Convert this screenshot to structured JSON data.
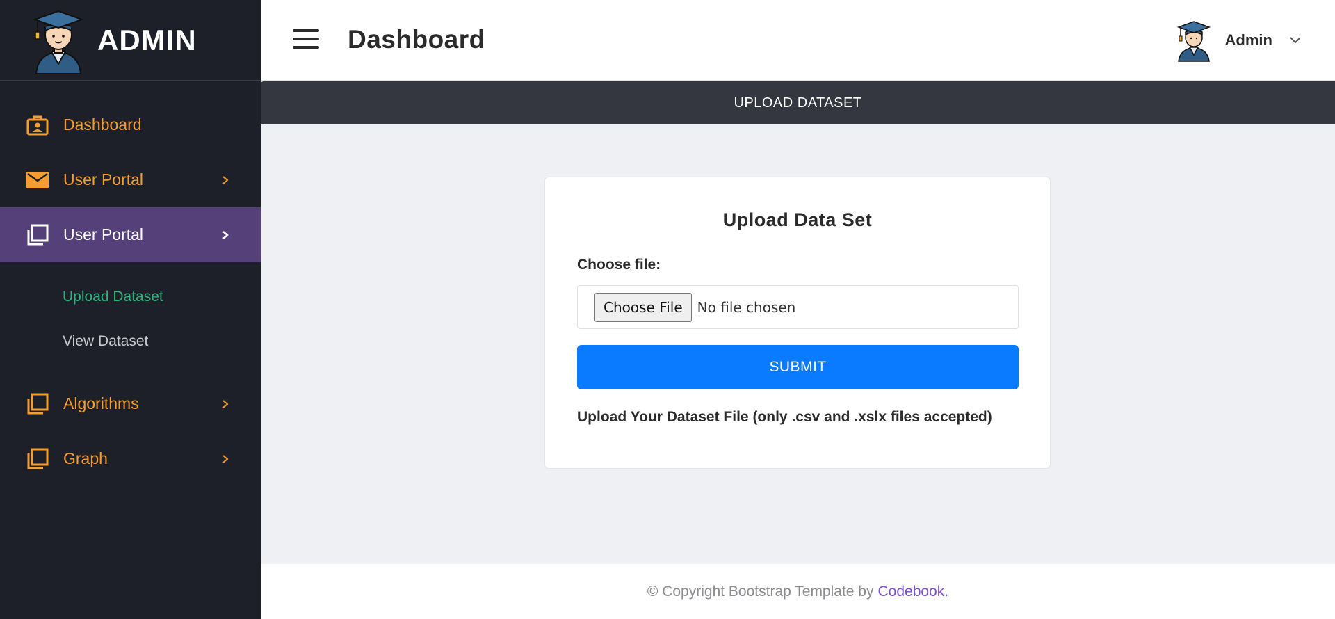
{
  "brand": {
    "name": "ADMIN"
  },
  "topbar": {
    "title": "Dashboard",
    "user_name": "Admin"
  },
  "sidebar": {
    "items": [
      {
        "label": "Dashboard",
        "icon": "briefcase-id-icon"
      },
      {
        "label": "User Portal",
        "icon": "envelope-icon"
      },
      {
        "label": "User Portal",
        "icon": "copy-icon",
        "active": true
      },
      {
        "label": "Algorithms",
        "icon": "copy-icon"
      },
      {
        "label": "Graph",
        "icon": "copy-icon"
      }
    ],
    "subitems": [
      {
        "label": "Upload Dataset",
        "active": true
      },
      {
        "label": "View Dataset"
      }
    ]
  },
  "section": {
    "header": "UPLOAD DATASET"
  },
  "form": {
    "title": "Upload Data Set",
    "file_label": "Choose file:",
    "file_button": "Choose File",
    "file_status": "No file chosen",
    "submit_label": "SUBMIT",
    "help_text": "Upload Your Dataset File (only .csv and .xslx files accepted)"
  },
  "footer": {
    "text": "© Copyright Bootstrap Template by",
    "link": "Codebook",
    "suffix": "."
  },
  "colors": {
    "sidebar_bg": "#1e2029",
    "accent_orange": "#f59e2e",
    "active_bg": "#55407a",
    "sub_active": "#2fb47c",
    "primary_button": "#0a7bff",
    "footer_link": "#7b4fc9"
  }
}
